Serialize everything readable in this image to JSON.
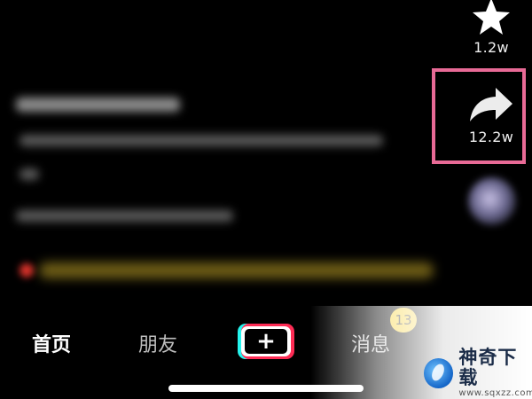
{
  "rail": {
    "favorite": {
      "icon": "star-icon",
      "count": "1.2w"
    },
    "share": {
      "icon": "share-arrow-icon",
      "count": "12.2w",
      "highlight_color": "#e86a96"
    }
  },
  "nav": {
    "home_label": "首页",
    "friends_label": "朋友",
    "create_icon": "plus-icon",
    "messages_label": "消息",
    "messages_badge": "13"
  },
  "watermark": {
    "name": "神奇下载",
    "url": "www.sqxzz.com"
  },
  "colors": {
    "background": "#000000",
    "badge": "#f7d02a",
    "plus_left_accent": "#25f4ee",
    "plus_right_accent": "#fe2c55"
  }
}
